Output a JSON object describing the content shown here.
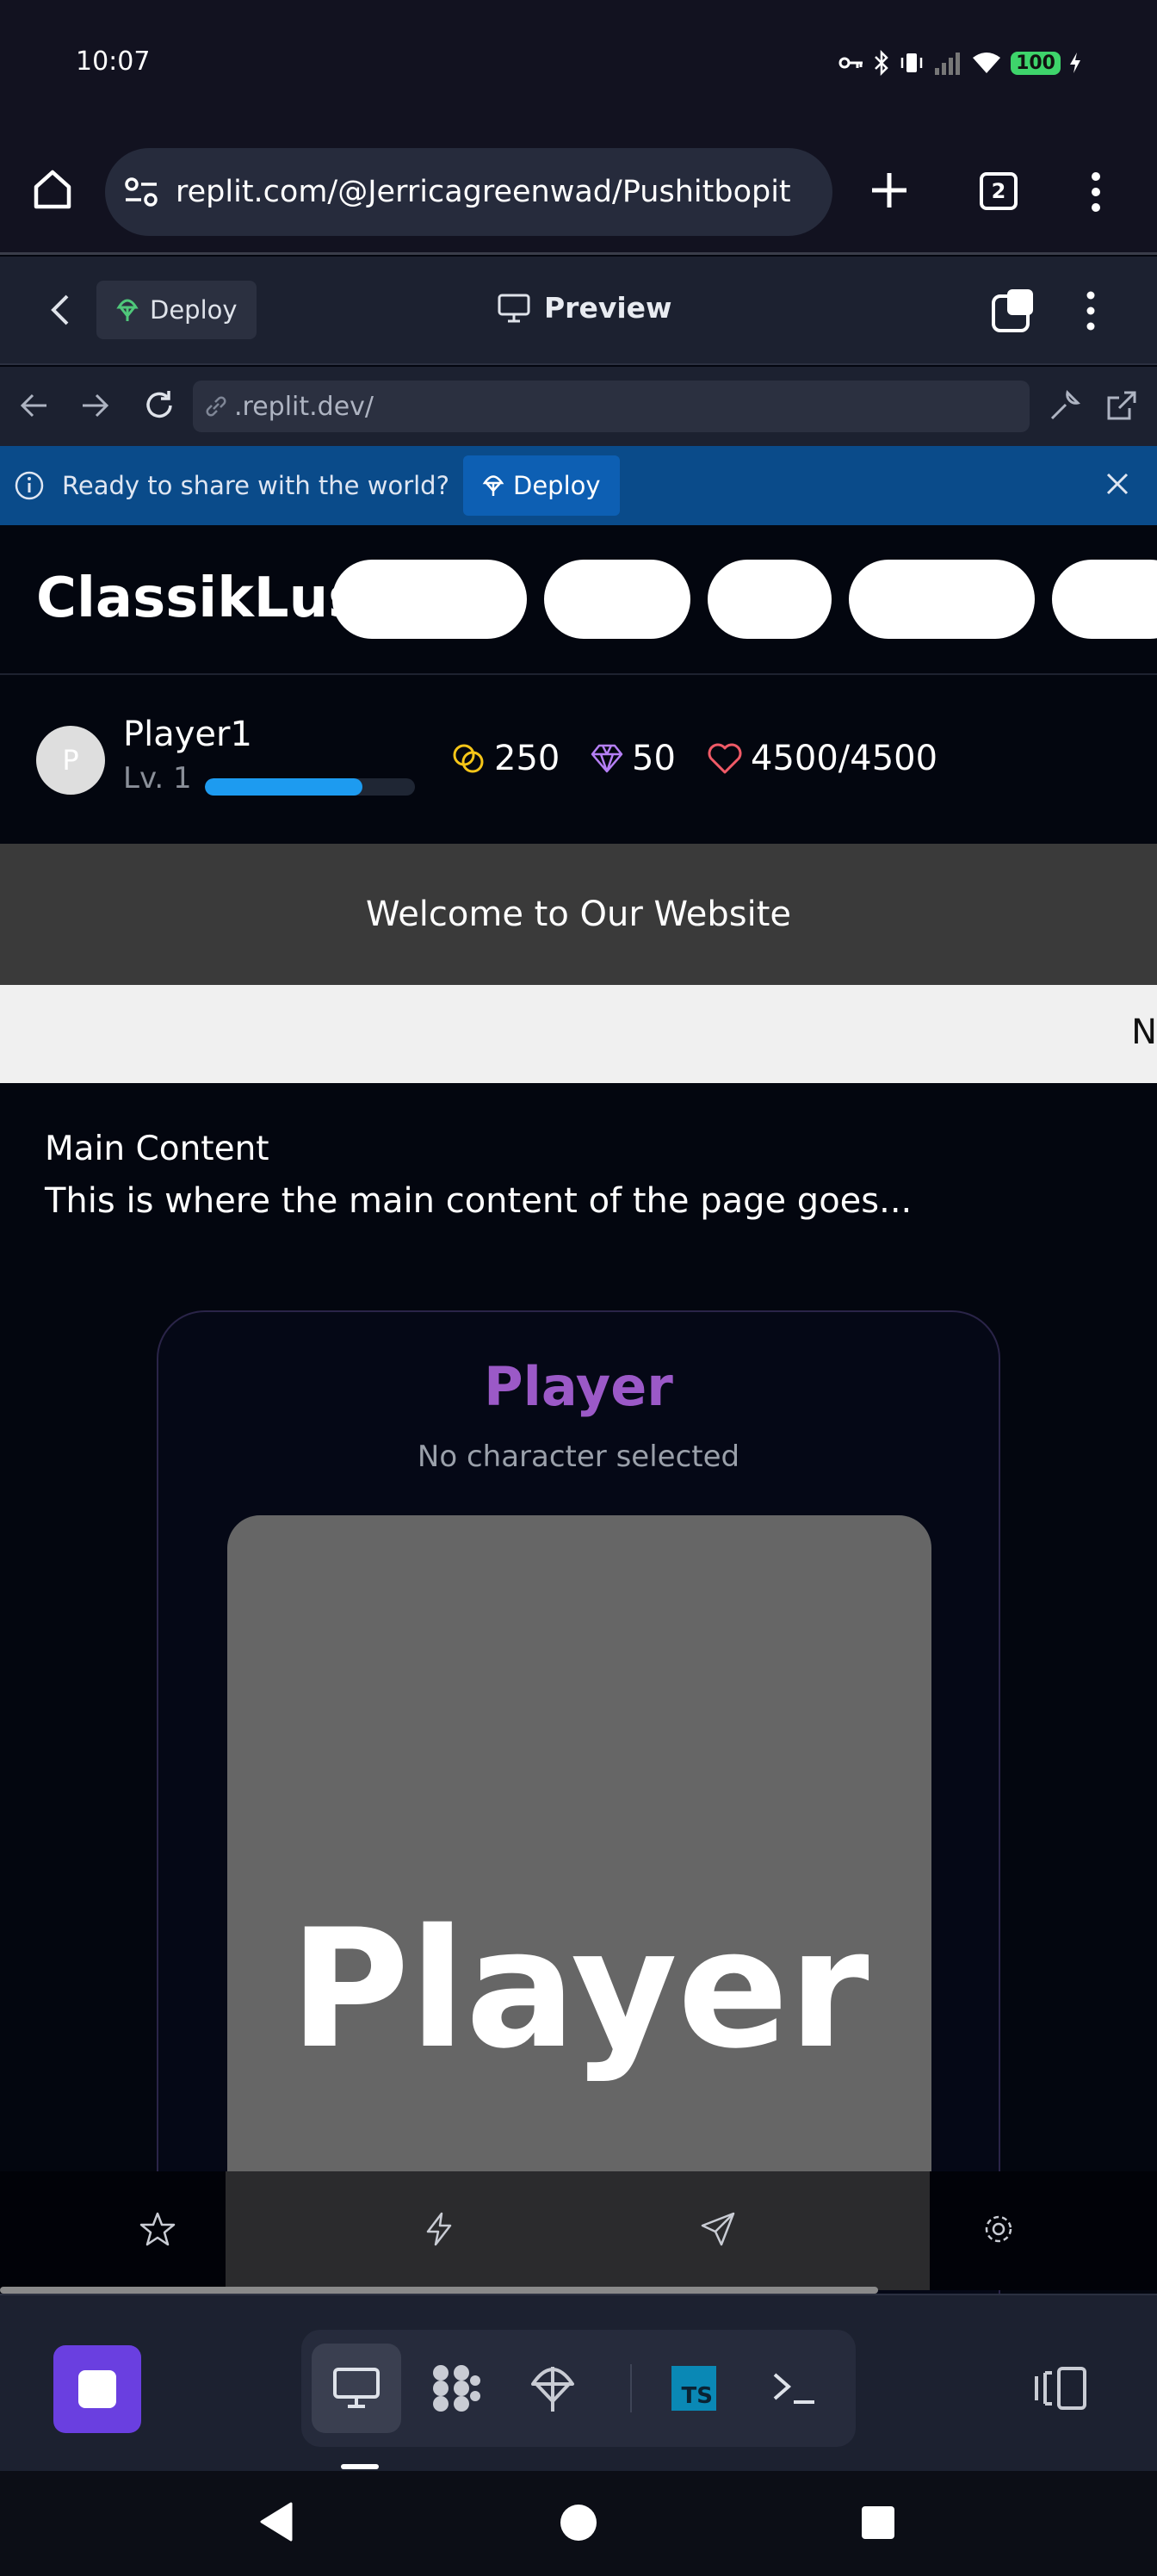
{
  "status_bar": {
    "time": "10:07",
    "battery": "100"
  },
  "browser": {
    "url": "replit.com/@Jerricagreenwad/Pushitbopit",
    "tab_count": "2"
  },
  "replit_header": {
    "deploy_label": "Deploy",
    "preview_label": "Preview"
  },
  "webview": {
    "address": ".replit.dev/"
  },
  "banner": {
    "text": "Ready to share with the world?",
    "deploy_label": "Deploy"
  },
  "site": {
    "brand": "ClassikLust",
    "player": {
      "avatar_initial": "P",
      "name": "Player1",
      "level": "Lv. 1",
      "xp_fraction": 0.75,
      "coins": "250",
      "gems": "50",
      "health": "4500/4500"
    },
    "welcome": "Welcome to Our Website",
    "ticker": "N",
    "main_title": "Main Content",
    "main_desc": "This is where the main content of the page goes...",
    "card": {
      "title": "Player",
      "subtitle": "No character selected",
      "image_text": "Player"
    }
  },
  "colors": {
    "accent_purple": "#9b59c7",
    "xp_blue": "#1d9bf0",
    "coin_yellow": "#f5c518",
    "gem_purple": "#b57ff5",
    "heart_red": "#f05a67",
    "banner_blue": "#0a4b8a",
    "stop_purple": "#6a3fe0"
  }
}
